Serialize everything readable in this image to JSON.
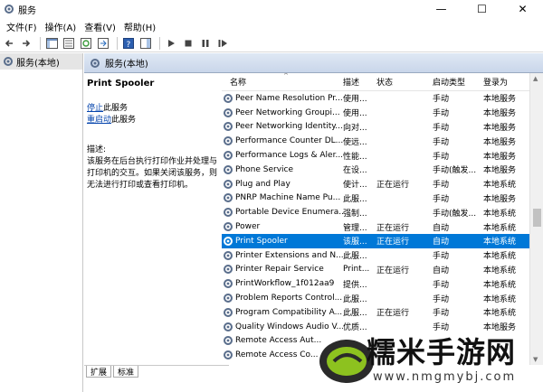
{
  "window": {
    "title": "服务",
    "minimize": "—",
    "maximize": "☐",
    "close": "✕"
  },
  "menu": [
    "文件(F)",
    "操作(A)",
    "查看(V)",
    "帮助(H)"
  ],
  "tree": {
    "selected": "服务(本地)"
  },
  "header": {
    "title": "服务(本地)"
  },
  "details": {
    "service_name": "Print Spooler",
    "stop_link": "停止",
    "stop_suffix": "此服务",
    "restart_link": "重启动",
    "restart_suffix": "此服务",
    "desc_label": "描述:",
    "desc_text": "该服务在后台执行打印作业并处理与打印机的交互。如果关闭该服务，则无法进行打印或查看打印机。"
  },
  "tabs": [
    "扩展",
    "标准"
  ],
  "columns": {
    "name": "名称",
    "desc": "描述",
    "status": "状态",
    "startup": "启动类型",
    "logon": "登录为"
  },
  "rows": [
    {
      "name": "Peer Name Resolution Pr...",
      "desc": "使用...",
      "status": "",
      "startup": "手动",
      "logon": "本地服务"
    },
    {
      "name": "Peer Networking Groupi...",
      "desc": "使用...",
      "status": "",
      "startup": "手动",
      "logon": "本地服务"
    },
    {
      "name": "Peer Networking Identity...",
      "desc": "向对...",
      "status": "",
      "startup": "手动",
      "logon": "本地服务"
    },
    {
      "name": "Performance Counter DL...",
      "desc": "使远...",
      "status": "",
      "startup": "手动",
      "logon": "本地服务"
    },
    {
      "name": "Performance Logs & Aler...",
      "desc": "性能...",
      "status": "",
      "startup": "手动",
      "logon": "本地服务"
    },
    {
      "name": "Phone Service",
      "desc": "在设...",
      "status": "",
      "startup": "手动(触发...",
      "logon": "本地服务"
    },
    {
      "name": "Plug and Play",
      "desc": "使计...",
      "status": "正在运行",
      "startup": "手动",
      "logon": "本地系统"
    },
    {
      "name": "PNRP Machine Name Pu...",
      "desc": "此服...",
      "status": "",
      "startup": "手动",
      "logon": "本地服务"
    },
    {
      "name": "Portable Device Enumera...",
      "desc": "强制...",
      "status": "",
      "startup": "手动(触发...",
      "logon": "本地系统"
    },
    {
      "name": "Power",
      "desc": "管理...",
      "status": "正在运行",
      "startup": "自动",
      "logon": "本地系统"
    },
    {
      "name": "Print Spooler",
      "desc": "该服...",
      "status": "正在运行",
      "startup": "自动",
      "logon": "本地系统",
      "selected": true
    },
    {
      "name": "Printer Extensions and N...",
      "desc": "此服...",
      "status": "",
      "startup": "手动",
      "logon": "本地系统"
    },
    {
      "name": "Printer Repair Service",
      "desc": "Print...",
      "status": "正在运行",
      "startup": "自动",
      "logon": "本地系统"
    },
    {
      "name": "PrintWorkflow_1f012aa9",
      "desc": "提供...",
      "status": "",
      "startup": "手动",
      "logon": "本地系统"
    },
    {
      "name": "Problem Reports Control...",
      "desc": "此服...",
      "status": "",
      "startup": "手动",
      "logon": "本地系统"
    },
    {
      "name": "Program Compatibility A...",
      "desc": "此服...",
      "status": "正在运行",
      "startup": "手动",
      "logon": "本地系统"
    },
    {
      "name": "Quality Windows Audio V...",
      "desc": "优质...",
      "status": "",
      "startup": "手动",
      "logon": "本地服务"
    },
    {
      "name": "Remote Access Aut...",
      "desc": "",
      "status": "",
      "startup": "",
      "logon": ""
    },
    {
      "name": "Remote Access Co...",
      "desc": "",
      "status": "",
      "startup": "",
      "logon": ""
    }
  ],
  "logo": {
    "text": "糯米手游网",
    "url": "www.nmgmybj.com"
  },
  "colors": {
    "selection": "#0078d7",
    "link": "#0645ad"
  }
}
